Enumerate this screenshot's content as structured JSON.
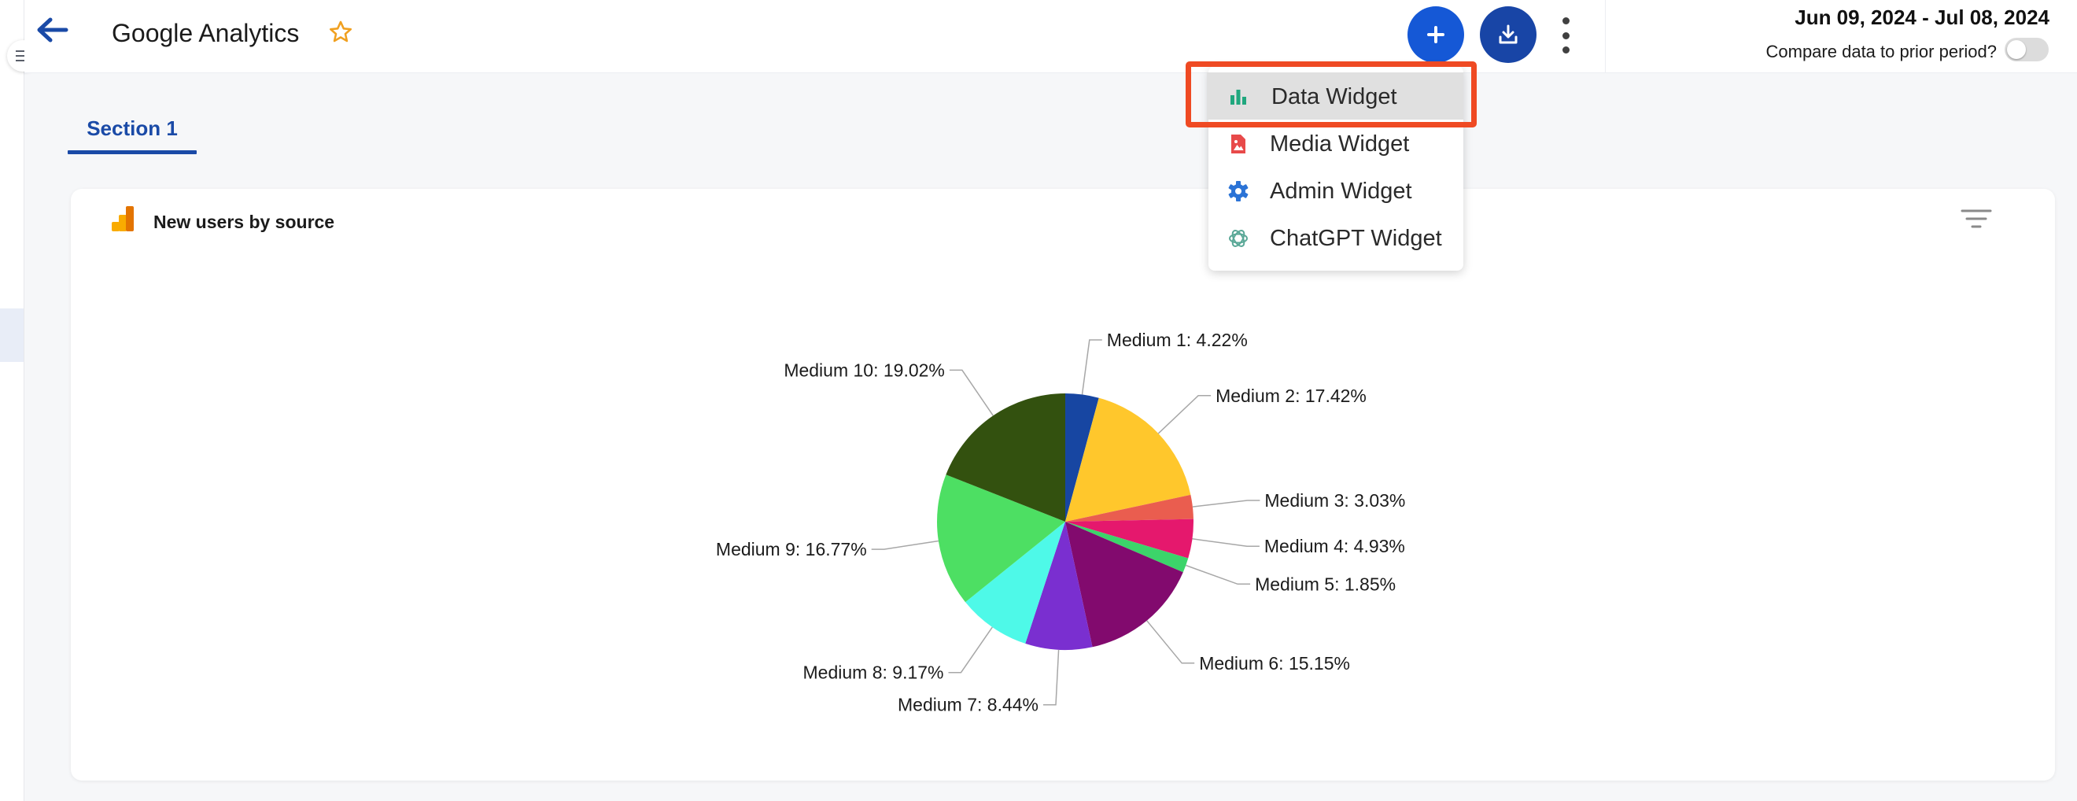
{
  "app": {
    "title": "Google Analytics",
    "date_range": "Jun 09, 2024 - Jul 08, 2024",
    "compare_label": "Compare data to prior period?",
    "compare_enabled": false,
    "icons": {
      "menu": "hamburger-icon",
      "back": "arrow-left-icon",
      "favorite": "star-outline-icon",
      "add": "plus-icon",
      "download": "download-icon",
      "more": "more-vertical-icon"
    }
  },
  "tabs": [
    {
      "label": "Section 1",
      "active": true
    }
  ],
  "dropdown": {
    "items": [
      {
        "label": "Data Widget",
        "icon": "bar-chart-icon",
        "color": "#20a77e",
        "highlighted": true
      },
      {
        "label": "Media Widget",
        "icon": "image-file-icon",
        "color": "#e84a4a",
        "highlighted": false
      },
      {
        "label": "Admin Widget",
        "icon": "gear-icon",
        "color": "#2b73d6",
        "highlighted": false
      },
      {
        "label": "ChatGPT Widget",
        "icon": "openai-icon",
        "color": "#5aa897",
        "highlighted": false
      }
    ]
  },
  "widget": {
    "title": "New users by source",
    "icon": "google-analytics-icon",
    "filter_icon": "filter-icon"
  },
  "chart_data": {
    "type": "pie",
    "title": "",
    "labels": [
      "Medium 1: 4.22%",
      "Medium 2: 17.42%",
      "Medium 3: 3.03%",
      "Medium 4: 4.93%",
      "Medium 5: 1.85%",
      "Medium 6: 15.15%",
      "Medium 7: 8.44%",
      "Medium 8: 9.17%",
      "Medium 9: 16.77%",
      "Medium 10: 19.02%"
    ],
    "values": [
      4.22,
      17.42,
      3.03,
      4.93,
      1.85,
      15.15,
      8.44,
      9.17,
      16.77,
      19.02
    ],
    "colors": [
      "#1746a2",
      "#ffc72c",
      "#ea5d4f",
      "#e5186d",
      "#3cd46a",
      "#820a6e",
      "#7a2fd0",
      "#4ef9e8",
      "#4ddf63",
      "#33510f"
    ],
    "start_angle": "top",
    "direction": "clockwise",
    "legend": "none"
  }
}
